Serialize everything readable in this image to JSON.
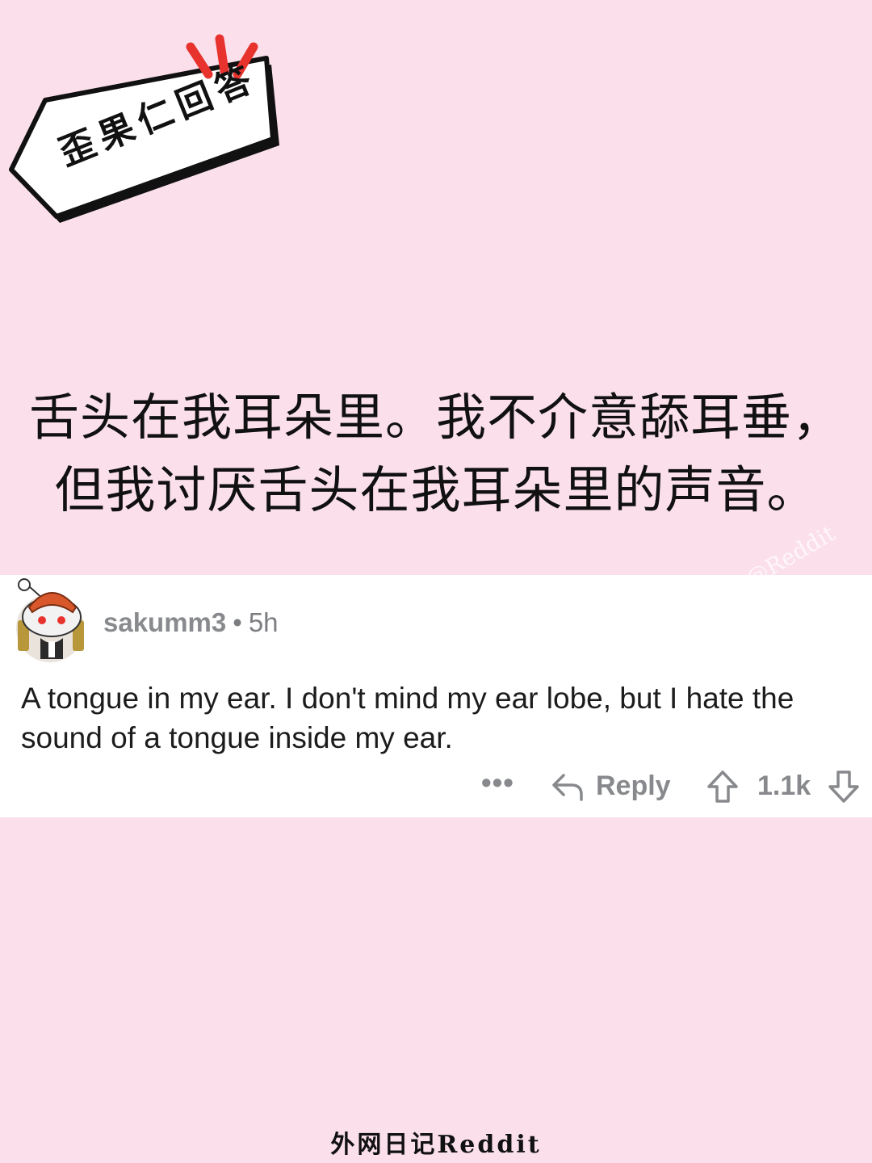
{
  "sticker": {
    "label": "歪果仁回答"
  },
  "headline": {
    "line1": "舌头在我耳朵里。我不介意舔耳垂，",
    "line2": "但我讨厌舌头在我耳朵里的声音。"
  },
  "comment": {
    "username": "sakumm3",
    "separator": "•",
    "time": "5h",
    "body": "A tongue in my ear. I don't mind my ear lobe, but I hate the sound of a tongue inside my ear.",
    "actions": {
      "more_label": "•••",
      "reply_label": "Reply",
      "score": "1.1k"
    }
  },
  "watermark": "@Reddit",
  "footer_brand": "外网日记Reddit",
  "colors": {
    "background": "#fbe0ec",
    "card": "#ffffff",
    "sticker_accent": "#e8322e",
    "action_gray": "#87898c"
  },
  "icons": [
    "reply-arrow-icon",
    "upvote-arrow-icon",
    "downvote-arrow-icon",
    "more-dots-icon",
    "avatar-snoo-icon",
    "burst-lines-icon"
  ]
}
